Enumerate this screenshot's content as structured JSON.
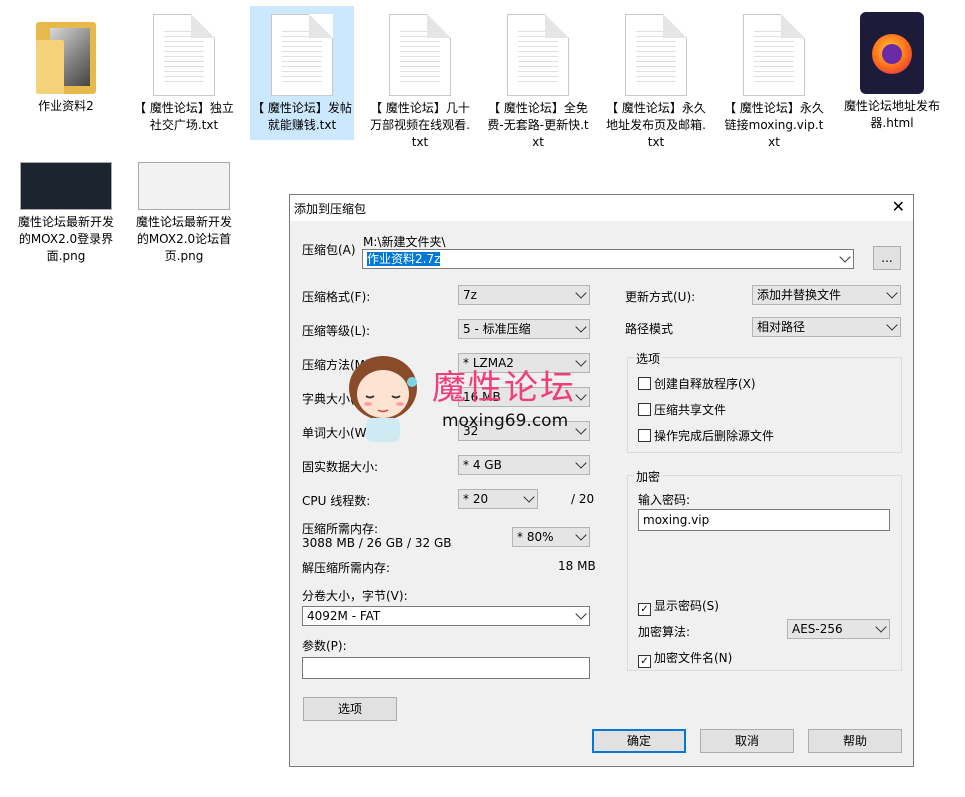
{
  "desktop_files": [
    {
      "label": "作业资料2",
      "kind": "folder"
    },
    {
      "label": "【 魔性论坛】独立社交广场.txt",
      "kind": "txt"
    },
    {
      "label": "【 魔性论坛】发帖就能赚钱.txt",
      "kind": "txt"
    },
    {
      "label": "【 魔性论坛】几十万部视频在线观看.txt",
      "kind": "txt"
    },
    {
      "label": "【 魔性论坛】全免费-无套路-更新快.txt",
      "kind": "txt"
    },
    {
      "label": "【 魔性论坛】永久地址发布页及邮箱.txt",
      "kind": "txt"
    },
    {
      "label": "【 魔性论坛】永久链接moxing.vip.txt",
      "kind": "txt"
    },
    {
      "label": "魔性论坛地址发布器.html",
      "kind": "html"
    },
    {
      "label": "魔性论坛最新开发的MOX2.0登录界面.png",
      "kind": "png"
    },
    {
      "label": "魔性论坛最新开发的MOX2.0论坛首页.png",
      "kind": "png"
    }
  ],
  "dialog": {
    "title": "添加到压缩包",
    "close": "✕",
    "archive_label": "压缩包(A)",
    "archive_path": "M:\\新建文件夹\\",
    "archive_name": "作业资料2.7z",
    "browse_btn": "...",
    "format_label": "压缩格式(F):",
    "format_value": "7z",
    "level_label": "压缩等级(L):",
    "level_value": "5 - 标准压缩",
    "method_label": "压缩方法(M):",
    "method_value": "* LZMA2",
    "dict_label": "字典大小(D):",
    "dict_value": "16 MB",
    "word_label": "单词大小(W):",
    "word_value": "32",
    "solid_label": "固实数据大小:",
    "solid_value": "* 4 GB",
    "cpu_label": "CPU 线程数:",
    "cpu_value": "* 20",
    "cpu_max": "/ 20",
    "mem_label": "压缩所需内存:",
    "mem_detail": "3088 MB / 26 GB / 32 GB",
    "mem_value": "* 80%",
    "decomp_label": "解压缩所需内存:",
    "decomp_value": "18 MB",
    "volume_label": "分卷大小，字节(V):",
    "volume_value": "4092M - FAT",
    "params_label": "参数(P):",
    "params_value": "",
    "options_btn": "选项",
    "update_label": "更新方式(U):",
    "update_value": "添加并替换文件",
    "path_label": "路径模式",
    "path_value": "相对路径",
    "options_group": "选项",
    "opt_sfx": "创建自释放程序(X)",
    "opt_shared": "压缩共享文件",
    "opt_delete": "操作完成后删除源文件",
    "encrypt_group": "加密",
    "password_label": "输入密码:",
    "password_value": "moxing.vip",
    "show_password": "显示密码(S)",
    "algo_label": "加密算法:",
    "algo_value": "AES-256",
    "encrypt_names": "加密文件名(N)",
    "ok": "确定",
    "cancel": "取消",
    "help": "帮助"
  },
  "watermark": {
    "title": "魔性论坛",
    "url": "moxing69.com"
  }
}
